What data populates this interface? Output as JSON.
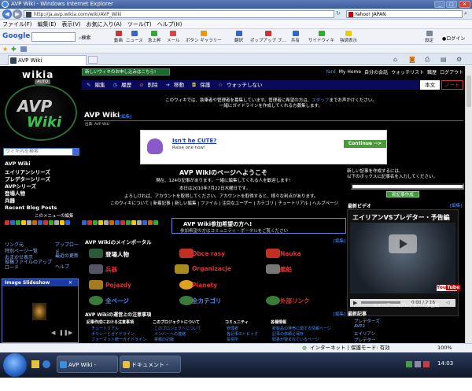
{
  "window": {
    "title": "AVP Wiki - Windows Internet Explorer"
  },
  "address": {
    "url": "http://ja.avp.wikia.com/wiki/AVP_Wiki",
    "search_engine": "Yahoo! JAPAN"
  },
  "menu": [
    "ファイル(F)",
    "編集(E)",
    "表示(V)",
    "お気に入り(A)",
    "ツール(T)",
    "ヘルプ(H)"
  ],
  "google_toolbar": {
    "logo": "Google",
    "search_label": "検索",
    "buttons": [
      "動画",
      "ニュース",
      "急上昇",
      "メール",
      "ボタン ギャラリー",
      "翻訳",
      "ポップアップ ブ...",
      "共有",
      "サイドウィキ",
      "強調表示"
    ],
    "settings": "設定",
    "login": "ログイン"
  },
  "tab": {
    "title": "AVP Wiki"
  },
  "wiki": {
    "brand": "wikia",
    "auto_badge": "AUTO",
    "logo_line1": "AVP",
    "logo_line2": "Wiki",
    "search_placeholder": "ウィキ内を検索",
    "nav": [
      "AVP Wiki",
      "エイリアンシリーズ",
      "プレデターシリーズ",
      "AVPシリーズ",
      "登場人物",
      "兵器",
      "Recent Blog Posts"
    ],
    "nav_edit": "このメニューの編集",
    "sidebar_links": [
      "リンク元",
      "特別ページ一覧",
      "おまかせ表示",
      "投稿ファイルのアップロード"
    ],
    "sidebar_links_right": [
      "アップロード",
      "最近の更新",
      "ヘルプ"
    ],
    "slideshow_title": "Image Slideshow",
    "banner": "新しいウィキのお申し込みはこちら!",
    "user_links": [
      "Yard",
      "My Home",
      "自分の会話",
      "ウォッチリスト",
      "職歴",
      "ログアウト"
    ],
    "actions": [
      "編集",
      "履歴",
      "削除",
      "移動",
      "保護",
      "ウォッチしない"
    ],
    "main_tab": "本文",
    "note_tab": "ノート",
    "admin_note_line1": "このウィキでは、執筆者や管理者を募集しています。管理者に希望の方は、",
    "admin_note_link": "スタッフ",
    "admin_note_line1_end": "までお声かけください。",
    "admin_note_line2": "一緒にガイドラインを作成してくれる方募集します。",
    "page_title": "AVP Wiki",
    "edit_link": "[編集]",
    "from": "出典: AVP Wiki",
    "ad_title": "Isn't he CUTE?",
    "ad_sub": "Raise one now!",
    "ad_button": "Continue -->",
    "welcome": "AVP Wikiのページへようこそ",
    "intro_line1": "現在、124の記事があります。一緒に編集してくれる人を歓迎します!",
    "intro_line2": "本日は2010年7月22日木曜日です。",
    "intro_line3": "よろしければ、アカウントを取得してください。アカウントを取得すると、様々な利点があります。",
    "intro_line4": "このウィキについて | 新着記事 | 新しい編集 | ファイル | 注目なユーザー | カテゴリ | チュートリアル | ヘルプページ",
    "join_title": "AVP Wiki参加希望の方へ!",
    "join_sub": "参加希望の方はコミュニティ・ポータルをご覧ください",
    "portal_heading": "AVP Wikiのメインポータル",
    "portal_edit": "[編集]",
    "portal_items": [
      {
        "label": "登場人物",
        "color": "#ffffff",
        "icon": "character-icon"
      },
      {
        "label": "Obce rasy",
        "color": "#e03030",
        "icon": "alien-icon"
      },
      {
        "label": "Nauka",
        "color": "#e03030",
        "icon": "science-icon"
      },
      {
        "label": "兵器",
        "color": "#e03030",
        "icon": "weapon-icon"
      },
      {
        "label": "Organizacje",
        "color": "#e03030",
        "icon": "organization-icon"
      },
      {
        "label": "艦船",
        "color": "#e03030",
        "icon": "ship-icon"
      },
      {
        "label": "Pojazdy",
        "color": "#e03030",
        "icon": "vehicle-icon"
      },
      {
        "label": "Planety",
        "color": "#e03030",
        "icon": "planet-icon"
      },
      {
        "label": "全ページ",
        "color": "#4a90ff",
        "icon": "pages-icon"
      },
      {
        "label": "全カテゴリ",
        "color": "#4a90ff",
        "icon": "category-icon"
      },
      {
        "label": "外部リンク",
        "color": "#e03030",
        "icon": "link-icon"
      }
    ],
    "new_page_text1": "新しい記事を作成するには、",
    "new_page_text2": "以下のボックスに記事名を入力してください。",
    "new_page_button": "新記事作成",
    "video_heading": "最新ビデオ",
    "video_title": "エイリアンVSプレデター・予告編",
    "video_time": "0:00 / 2:16",
    "video_caption": "エイリアンVSプレデター・予告編",
    "recent_heading": "最新記事",
    "recent_items": [
      "プレデターズ",
      "AVP2",
      "エイリアン",
      "プレデター"
    ],
    "notes_heading": "AVP Wikiの運営上の注意事項",
    "columns": [
      {
        "title": "記事作成における注意事項",
        "items": [
          "チュートリアル",
          "ポリシーとガイドライン",
          "フォーマット統一ガイドライン",
          "削除依頼ガイドライン"
        ]
      },
      {
        "title": "このプロジェクトについて",
        "items": [
          "このプロジェクトについて",
          "メンバーへの連絡",
          "寄稿の記録",
          "このサイトの案内"
        ]
      },
      {
        "title": "コミュニティ",
        "items": [
          "管理者",
          "各記事のトピック",
          "投票所",
          "議論ページ"
        ]
      },
      {
        "title": "各種情報",
        "items": [
          "新製品の発売に関する情報ページ",
          "記事の依頼と保存",
          "取扱が望まれているページ"
        ]
      }
    ]
  },
  "statusbar": {
    "zone": "インターネット | 保護モード: 有効",
    "zoom": "100%"
  },
  "taskbar": {
    "tasks": [
      "AVP Wiki - Windo...",
      "ドキュメント - ワ..."
    ],
    "clock": "14:03"
  }
}
